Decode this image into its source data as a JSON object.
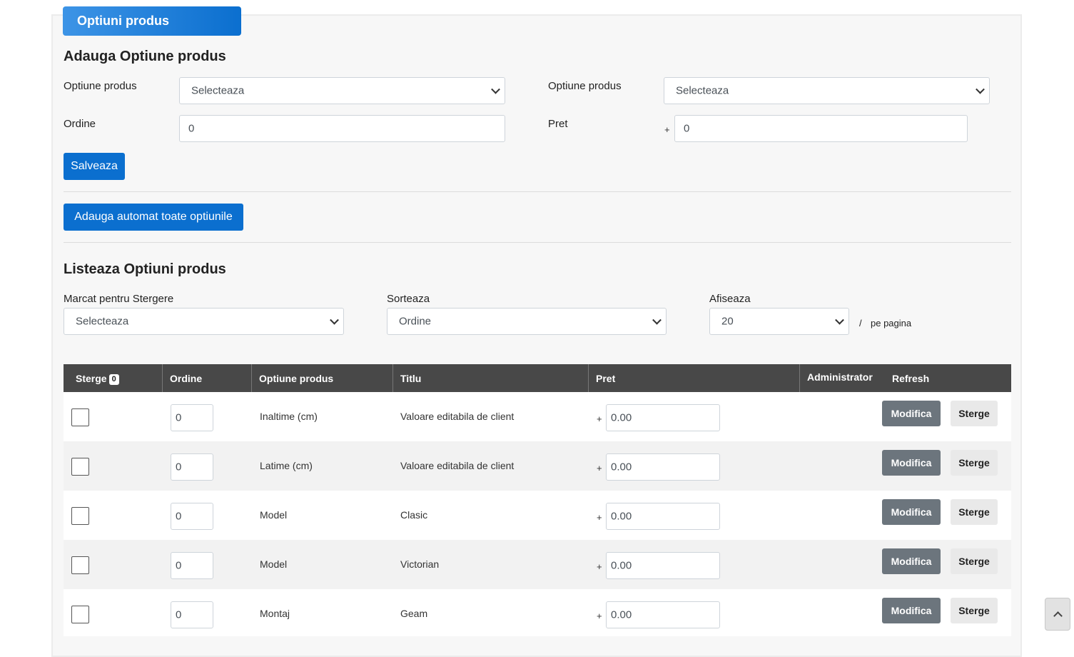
{
  "panel": {
    "title": "Optiuni produs"
  },
  "add_form": {
    "heading": "Adauga Optiune produs",
    "option_label_1": "Optiune produs",
    "option_value_1": "Selecteaza",
    "option_label_2": "Optiune produs",
    "option_value_2": "Selecteaza",
    "order_label": "Ordine",
    "order_value": "0",
    "price_label": "Pret",
    "price_sign": "+",
    "price_value": "0",
    "save_label": "Salveaza"
  },
  "auto_add_label": "Adauga automat toate optiunile",
  "list": {
    "heading": "Listeaza Optiuni produs",
    "marked_label": "Marcat pentru Stergere",
    "marked_value": "Selecteaza",
    "sort_label": "Sorteaza",
    "sort_value": "Ordine",
    "show_label": "Afiseaza",
    "show_value": "20",
    "per_page_slash": "/",
    "per_page_label": "pe pagina"
  },
  "table": {
    "headers": {
      "delete": "Sterge",
      "delete_count": "0",
      "order": "Ordine",
      "option": "Optiune produs",
      "title": "Titlu",
      "price": "Pret",
      "admin": "Administrator",
      "refresh": "Refresh"
    },
    "rows": [
      {
        "order": "0",
        "option": "Inaltime (cm)",
        "title": "Valoare editabila de client",
        "sign": "+",
        "price": "0.00",
        "edit": "Modifica",
        "delete": "Sterge"
      },
      {
        "order": "0",
        "option": "Latime (cm)",
        "title": "Valoare editabila de client",
        "sign": "+",
        "price": "0.00",
        "edit": "Modifica",
        "delete": "Sterge"
      },
      {
        "order": "0",
        "option": "Model",
        "title": "Clasic",
        "sign": "+",
        "price": "0.00",
        "edit": "Modifica",
        "delete": "Sterge"
      },
      {
        "order": "0",
        "option": "Model",
        "title": "Victorian",
        "sign": "+",
        "price": "0.00",
        "edit": "Modifica",
        "delete": "Sterge"
      },
      {
        "order": "0",
        "option": "Montaj",
        "title": "Geam",
        "sign": "+",
        "price": "0.00",
        "edit": "Modifica",
        "delete": "Sterge"
      }
    ]
  },
  "icons": {
    "scroll_top": "chevron-up-icon",
    "select_arrow": "chevron-down-icon"
  }
}
